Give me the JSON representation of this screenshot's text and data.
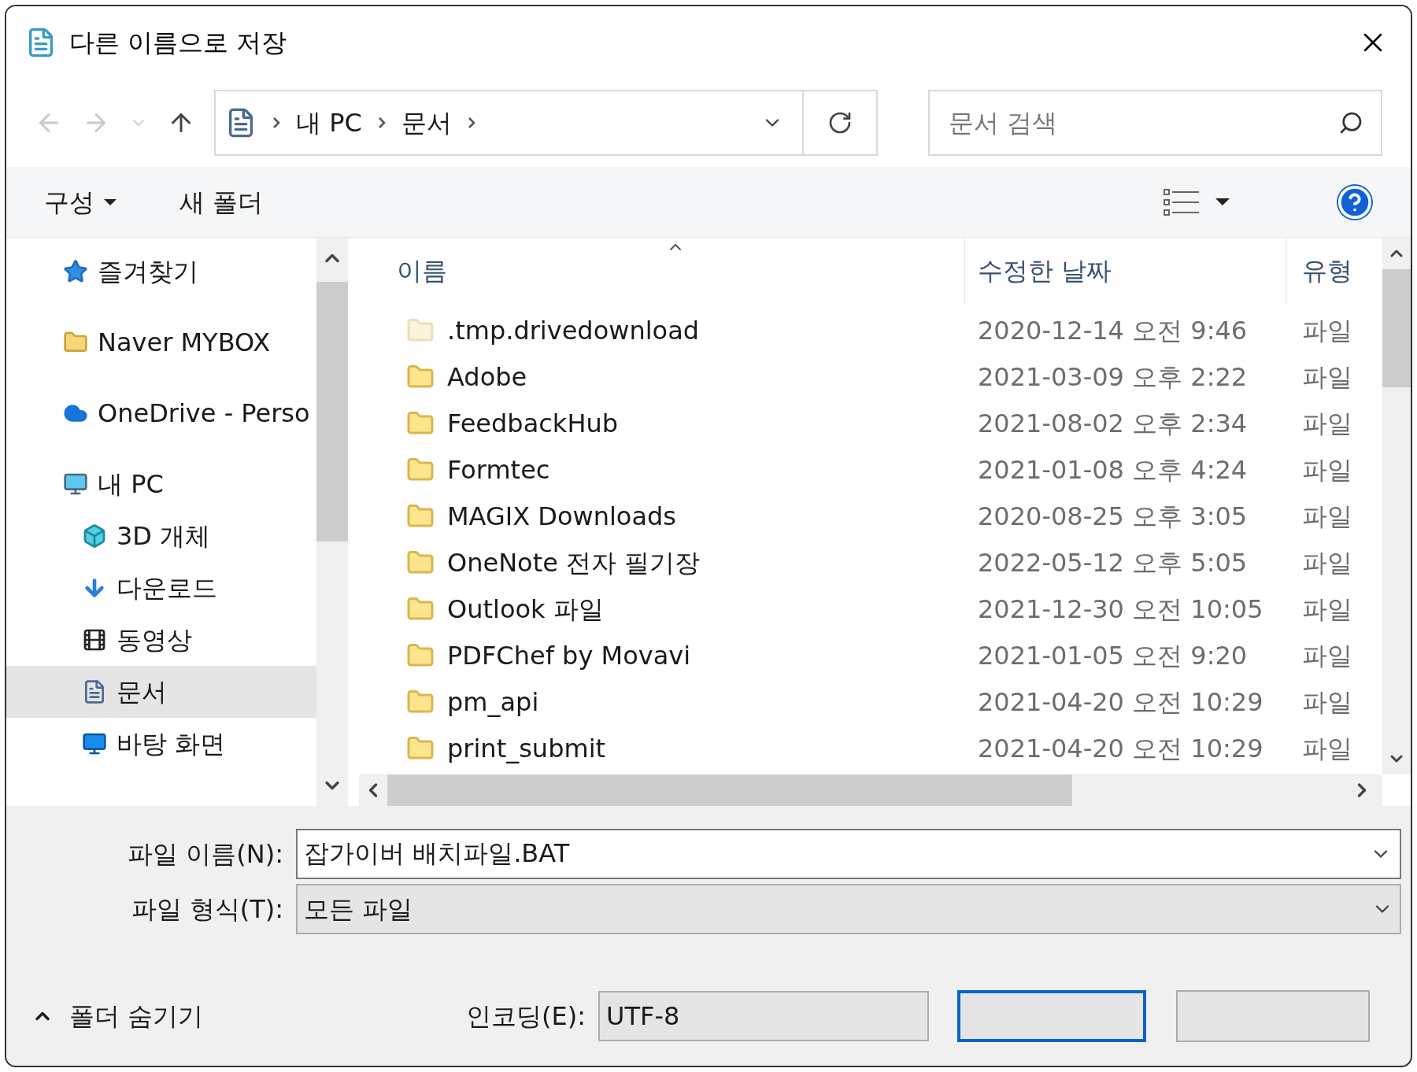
{
  "window": {
    "title": "다른 이름으로 저장"
  },
  "address_bar": {
    "path": [
      {
        "label": "내 PC"
      },
      {
        "label": "문서"
      }
    ]
  },
  "search": {
    "placeholder": "문서 검색"
  },
  "toolbar": {
    "organize": "구성",
    "new_folder": "새 폴더"
  },
  "sidebar": {
    "items": [
      {
        "label": "즐겨찾기",
        "selected": false
      },
      {
        "label": "Naver MYBOX",
        "selected": false
      },
      {
        "label": "OneDrive - Perso",
        "selected": false
      },
      {
        "label": "내 PC",
        "selected": false,
        "children": [
          {
            "label": "3D 개체",
            "selected": false
          },
          {
            "label": "다운로드",
            "selected": false
          },
          {
            "label": "동영상",
            "selected": false
          },
          {
            "label": "문서",
            "selected": true
          },
          {
            "label": "바탕 화면",
            "selected": false
          }
        ]
      }
    ]
  },
  "table": {
    "columns": [
      "이름",
      "수정한 날짜",
      "유형"
    ],
    "rows": [
      {
        "name": ".tmp.drivedownload",
        "modified": "2020-12-14 오전 9:46",
        "type": "파일",
        "hidden": true
      },
      {
        "name": "Adobe",
        "modified": "2021-03-09 오후 2:22",
        "type": "파일",
        "hidden": false
      },
      {
        "name": "FeedbackHub",
        "modified": "2021-08-02 오후 2:34",
        "type": "파일",
        "hidden": false
      },
      {
        "name": "Formtec",
        "modified": "2021-01-08 오후 4:24",
        "type": "파일",
        "hidden": false
      },
      {
        "name": "MAGIX Downloads",
        "modified": "2020-08-25 오후 3:05",
        "type": "파일",
        "hidden": false
      },
      {
        "name": "OneNote 전자 필기장",
        "modified": "2022-05-12 오후 5:05",
        "type": "파일",
        "hidden": false
      },
      {
        "name": "Outlook 파일",
        "modified": "2021-12-30 오전 10:05",
        "type": "파일",
        "hidden": false
      },
      {
        "name": "PDFChef by Movavi",
        "modified": "2021-01-05 오전 9:20",
        "type": "파일",
        "hidden": false
      },
      {
        "name": "pm_api",
        "modified": "2021-04-20 오전 10:29",
        "type": "파일",
        "hidden": false
      },
      {
        "name": "print_submit",
        "modified": "2021-04-20 오전 10:29",
        "type": "파일",
        "hidden": false
      }
    ]
  },
  "file_name": {
    "label": "파일 이름(N):",
    "value": "잡가이버 배치파일.BAT"
  },
  "file_type": {
    "label": "파일 형식(T):",
    "value": "모든 파일"
  },
  "encoding": {
    "label": "인코딩(E):",
    "value": "UTF-8"
  },
  "hide_folders": "폴더 숨기기"
}
